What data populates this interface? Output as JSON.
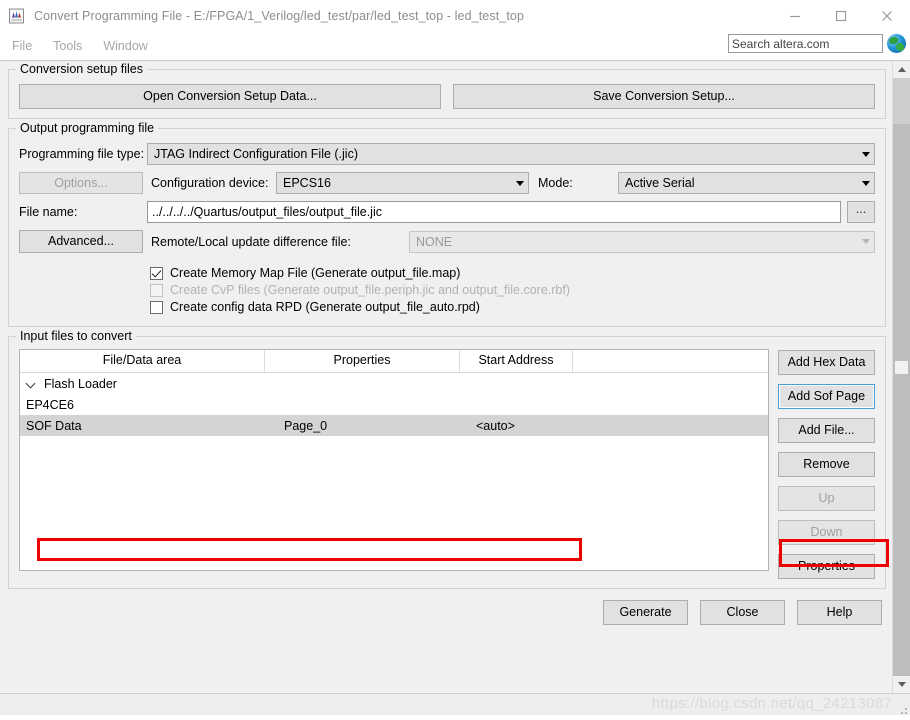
{
  "window": {
    "title": "Convert Programming File - E:/FPGA/1_Verilog/led_test/par/led_test_top - led_test_top",
    "icon": "quartus-app-icon",
    "minimize_label": "—",
    "maximize_label": "☐",
    "close_label": "✕"
  },
  "menubar": {
    "items": [
      {
        "label": "File"
      },
      {
        "label": "Tools"
      },
      {
        "label": "Window"
      }
    ]
  },
  "search": {
    "placeholder": "Search altera.com",
    "value": "",
    "icon": "globe-icon"
  },
  "conversion_setup": {
    "legend": "Conversion setup files",
    "open_button": "Open Conversion Setup Data...",
    "save_button": "Save Conversion Setup..."
  },
  "output_programming_file": {
    "legend": "Output programming file",
    "programming_file_type_label": "Programming file type:",
    "programming_file_type_value": "JTAG Indirect Configuration File (.jic)",
    "options_button": "Options...",
    "configuration_device_label": "Configuration device:",
    "configuration_device_value": "EPCS16",
    "mode_label": "Mode:",
    "mode_value": "Active Serial",
    "file_name_label": "File name:",
    "file_name_value": "../../../../Quartus/output_files/output_file.jic",
    "browse_button": "...",
    "advanced_button": "Advanced...",
    "remote_local_label": "Remote/Local update difference file:",
    "remote_local_value": "NONE",
    "checkboxes": [
      {
        "label": "Create Memory Map File (Generate output_file.map)",
        "checked": true,
        "enabled": true
      },
      {
        "label": "Create CvP files (Generate output_file.periph.jic and output_file.core.rbf)",
        "checked": false,
        "enabled": false
      },
      {
        "label": "Create config data RPD (Generate output_file_auto.rpd)",
        "checked": false,
        "enabled": true
      }
    ]
  },
  "input_files": {
    "legend": "Input files to convert",
    "columns": [
      "File/Data area",
      "Properties",
      "Start Address",
      ""
    ],
    "rows": [
      {
        "file_data_area": "Flash Loader",
        "properties": "",
        "start_address": "",
        "indent": 0,
        "expandable": true,
        "selected": false
      },
      {
        "file_data_area": "EP4CE6",
        "properties": "",
        "start_address": "",
        "indent": 2,
        "expandable": false,
        "selected": false
      },
      {
        "file_data_area": "SOF Data",
        "properties": "Page_0",
        "start_address": "<auto>",
        "indent": 0,
        "expandable": false,
        "selected": true
      }
    ],
    "side_buttons": [
      {
        "label": "Add Hex Data",
        "enabled": true,
        "focused": false
      },
      {
        "label": "Add Sof Page",
        "enabled": true,
        "focused": true
      },
      {
        "label": "Add File...",
        "enabled": true,
        "focused": false
      },
      {
        "label": "Remove",
        "enabled": true,
        "focused": false
      },
      {
        "label": "Up",
        "enabled": false,
        "focused": false
      },
      {
        "label": "Down",
        "enabled": false,
        "focused": false
      },
      {
        "label": "Properties",
        "enabled": true,
        "focused": false
      }
    ]
  },
  "dialog_buttons": [
    {
      "label": "Generate",
      "enabled": true
    },
    {
      "label": "Close",
      "enabled": true
    },
    {
      "label": "Help",
      "enabled": true
    }
  ],
  "annotations": {
    "row_highlight": "sof-data-row",
    "button_highlight": "add-file-button"
  },
  "watermark": "https://blog.csdn.net/qq_24213087",
  "accent_colors": {
    "annotation_red": "#ee0000",
    "focus_blue": "#4b9ed7",
    "selection_gray": "#d4d4d4",
    "dialog_bg": "#f0f0f0"
  }
}
